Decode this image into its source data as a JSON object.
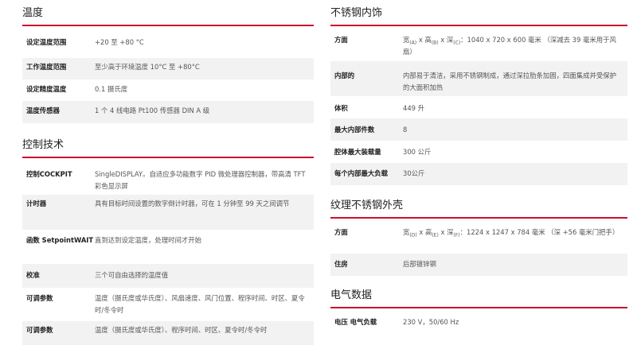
{
  "left": {
    "sections": [
      {
        "title": "温度",
        "rows": [
          {
            "label": "设定温度范围",
            "value": "+20 至 +80 °C"
          },
          {
            "label": "工作温度范围",
            "value": "至少高于环境温度 10°C 至 +80°C"
          },
          {
            "label": "设定精度温度",
            "value": "0.1 摄氏度"
          },
          {
            "label": "温度传感器",
            "value": "1 个 4 线电路 Pt100 传感器 DIN A 级"
          }
        ]
      },
      {
        "title": "控制技术",
        "rows": [
          {
            "label": "控制COCKPIT",
            "value": "SingleDISPLAY。自适应多功能数字 PID 微处理器控制器，带高清 TFT 彩色显示屏"
          },
          {
            "label": "计时器",
            "value": "具有目标时间设置的数字倒计时器，可在 1 分钟至 99 天之间调节"
          },
          {
            "label": "函数 SetpointWAIT",
            "value": "直到达到设定温度，处理时间才开始"
          },
          {
            "label": "校准",
            "value": "三个可自由选择的温度值"
          },
          {
            "label": "可调参数",
            "value": "温度（摄氏度或华氏度）、风扇速度、风门位置、程序时间、时区、夏令时/冬令时"
          },
          {
            "label": "可调参数",
            "value": "温度（摄氏度或华氏度）、程序时间、时区、夏令时/冬令时"
          }
        ]
      }
    ]
  },
  "right": {
    "sections": [
      {
        "title": "不锈钢内饰",
        "rows": [
          {
            "label": "方面",
            "pre": "宽",
            "s1": "(A)",
            "m1": " x 高",
            "s2": "(B)",
            "m2": " x 深",
            "s3": "(C)",
            "post": "：1040 x 720 x 600 毫米 （深减去 39 毫米用于风扇）"
          },
          {
            "label": "内部的",
            "value": "内部易于清洁，采用不锈钢制成，通过深拉肋条加固，四面集成并受保护的大面积加热"
          },
          {
            "label": "体积",
            "value": "449 升"
          },
          {
            "label": "最大内部件数",
            "value": "8"
          },
          {
            "label": "腔体最大装载量",
            "value": "300 公斤"
          },
          {
            "label": "每个内部最大负载",
            "value": "30公斤"
          }
        ]
      },
      {
        "title": "纹理不锈钢外壳",
        "rows": [
          {
            "label": "方面",
            "pre": "宽",
            "s1": "(D)",
            "m1": " x 高",
            "s2": "(E)",
            "m2": " x 深",
            "s3": "(F)",
            "post": "：1224 x 1247 x 784 毫米 （深 +56 毫米门把手）"
          },
          {
            "label": "住房",
            "value": "后部镀锌钢"
          }
        ]
      },
      {
        "title": "电气数据",
        "rows": [
          {
            "label": "电压 电气负载",
            "value": "230 V，50/60 Hz"
          }
        ]
      }
    ]
  },
  "colors": {
    "accent_rule": "#c8102e",
    "row_shade": "#f2f2f2"
  }
}
